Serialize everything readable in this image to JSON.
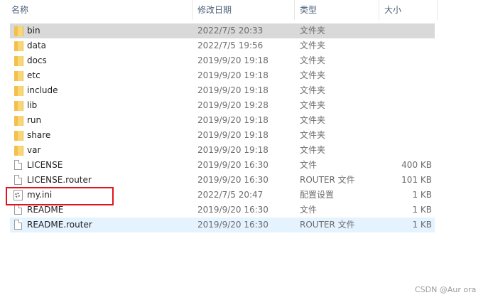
{
  "header": {
    "name": "名称",
    "date_modified": "修改日期",
    "type": "类型",
    "size": "大小",
    "sort_indicator": "^"
  },
  "files": [
    {
      "name": "bin",
      "date": "2022/7/5 20:33",
      "type": "文件夹",
      "size": "",
      "icon": "folder-icon",
      "state": "selected"
    },
    {
      "name": "data",
      "date": "2022/7/5 19:56",
      "type": "文件夹",
      "size": "",
      "icon": "folder-icon",
      "state": ""
    },
    {
      "name": "docs",
      "date": "2019/9/20 19:18",
      "type": "文件夹",
      "size": "",
      "icon": "folder-icon",
      "state": ""
    },
    {
      "name": "etc",
      "date": "2019/9/20 19:18",
      "type": "文件夹",
      "size": "",
      "icon": "folder-icon",
      "state": ""
    },
    {
      "name": "include",
      "date": "2019/9/20 19:18",
      "type": "文件夹",
      "size": "",
      "icon": "folder-icon",
      "state": ""
    },
    {
      "name": "lib",
      "date": "2019/9/20 19:28",
      "type": "文件夹",
      "size": "",
      "icon": "folder-icon",
      "state": ""
    },
    {
      "name": "run",
      "date": "2019/9/20 19:18",
      "type": "文件夹",
      "size": "",
      "icon": "folder-icon",
      "state": ""
    },
    {
      "name": "share",
      "date": "2019/9/20 19:18",
      "type": "文件夹",
      "size": "",
      "icon": "folder-icon",
      "state": ""
    },
    {
      "name": "var",
      "date": "2019/9/20 19:18",
      "type": "文件夹",
      "size": "",
      "icon": "folder-icon",
      "state": ""
    },
    {
      "name": "LICENSE",
      "date": "2019/9/20 16:30",
      "type": "文件",
      "size": "400 KB",
      "icon": "file-icon",
      "state": ""
    },
    {
      "name": "LICENSE.router",
      "date": "2019/9/20 16:30",
      "type": "ROUTER 文件",
      "size": "101 KB",
      "icon": "file-icon",
      "state": ""
    },
    {
      "name": "my.ini",
      "date": "2022/7/5 20:47",
      "type": "配置设置",
      "size": "1 KB",
      "icon": "config-icon",
      "state": "highlighted"
    },
    {
      "name": "README",
      "date": "2019/9/20 16:30",
      "type": "文件",
      "size": "1 KB",
      "icon": "file-icon",
      "state": ""
    },
    {
      "name": "README.router",
      "date": "2019/9/20 16:30",
      "type": "ROUTER 文件",
      "size": "1 KB",
      "icon": "file-icon",
      "state": "hover"
    }
  ],
  "colors": {
    "selected_row": "#d9d9d9",
    "hover_row": "#e5f3ff",
    "highlight_box": "#e0141e",
    "folder": "#f8d774"
  },
  "watermark": "CSDN @Aur ora"
}
